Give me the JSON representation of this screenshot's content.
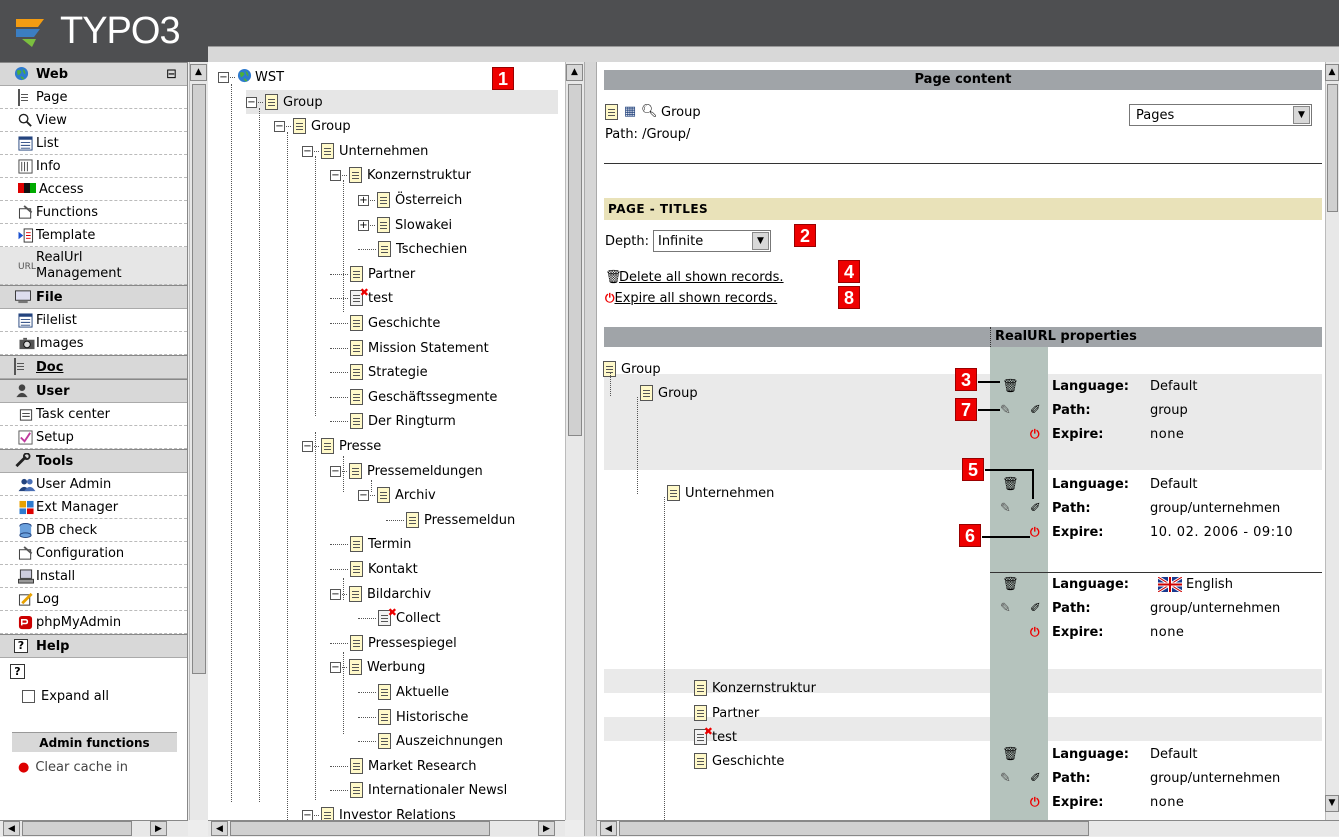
{
  "app": {
    "logo_text": "TYPO3"
  },
  "left_menu": {
    "sections": [
      {
        "title": "Web",
        "icon": "globe-icon",
        "collapse_symbol": "⊟",
        "items": [
          {
            "label": "Page",
            "icon": "page-icon"
          },
          {
            "label": "View",
            "icon": "magnifier-icon"
          },
          {
            "label": "List",
            "icon": "list-icon"
          },
          {
            "label": "Info",
            "icon": "info-icon"
          },
          {
            "label": "Access",
            "icon": "access-icon"
          },
          {
            "label": "Functions",
            "icon": "functions-icon"
          },
          {
            "label": "Template",
            "icon": "template-icon"
          },
          {
            "label": "RealUrl Management",
            "icon": "url-icon",
            "icon_text": "URL"
          }
        ]
      },
      {
        "title": "File",
        "icon": "file-icon",
        "items": [
          {
            "label": "Filelist",
            "icon": "filelist-icon"
          },
          {
            "label": "Images",
            "icon": "camera-icon"
          }
        ]
      },
      {
        "title": "Doc",
        "icon": "doc-icon",
        "items": []
      },
      {
        "title": "User",
        "icon": "user-icon",
        "items": [
          {
            "label": "Task center",
            "icon": "taskcenter-icon"
          },
          {
            "label": "Setup",
            "icon": "setup-icon"
          }
        ]
      },
      {
        "title": "Tools",
        "icon": "tools-icon",
        "items": [
          {
            "label": "User Admin",
            "icon": "useradmin-icon"
          },
          {
            "label": "Ext Manager",
            "icon": "extmanager-icon"
          },
          {
            "label": "DB check",
            "icon": "dbcheck-icon"
          },
          {
            "label": "Configuration",
            "icon": "configuration-icon"
          },
          {
            "label": "Install",
            "icon": "install-icon"
          },
          {
            "label": "Log",
            "icon": "log-icon"
          },
          {
            "label": "phpMyAdmin",
            "icon": "phpmyadmin-icon"
          }
        ]
      },
      {
        "title": "Help",
        "icon": "help-icon",
        "items": []
      }
    ],
    "help_icon_text": "?",
    "expand_all_label": "Expand all",
    "admin_functions_title": "Admin functions",
    "clear_cache_label": "Clear cache in"
  },
  "tree": {
    "badge": "1",
    "nodes": [
      {
        "label": "WST",
        "level": 0,
        "toggle": "⊟",
        "icon": "globe-icon"
      },
      {
        "label": "Group",
        "level": 1,
        "toggle": "⊟",
        "selected": true
      },
      {
        "label": "Group",
        "level": 2,
        "toggle": "⊟"
      },
      {
        "label": "Unternehmen",
        "level": 3,
        "toggle": "⊟"
      },
      {
        "label": "Konzernstruktur",
        "level": 4,
        "toggle": "⊟"
      },
      {
        "label": "Österreich",
        "level": 5,
        "toggle": "⊞"
      },
      {
        "label": "Slowakei",
        "level": 5,
        "toggle": "⊞"
      },
      {
        "label": "Tschechien",
        "level": 5
      },
      {
        "label": "Partner",
        "level": 4
      },
      {
        "label": "test",
        "level": 4,
        "hidden": true
      },
      {
        "label": "Geschichte",
        "level": 4
      },
      {
        "label": "Mission Statement",
        "level": 4
      },
      {
        "label": "Strategie",
        "level": 4
      },
      {
        "label": "Geschäftssegmente",
        "level": 4
      },
      {
        "label": "Der Ringturm",
        "level": 4
      },
      {
        "label": "Presse",
        "level": 3,
        "toggle": "⊟"
      },
      {
        "label": "Pressemeldungen",
        "level": 4,
        "toggle": "⊟"
      },
      {
        "label": "Archiv",
        "level": 5,
        "toggle": "⊟"
      },
      {
        "label": "Pressemeldun",
        "level": 6
      },
      {
        "label": "Termin",
        "level": 4
      },
      {
        "label": "Kontakt",
        "level": 4
      },
      {
        "label": "Bildarchiv",
        "level": 4,
        "toggle": "⊟"
      },
      {
        "label": "Collect",
        "level": 5,
        "hidden": true
      },
      {
        "label": "Pressespiegel",
        "level": 4
      },
      {
        "label": "Werbung",
        "level": 4,
        "toggle": "⊟"
      },
      {
        "label": "Aktuelle",
        "level": 5
      },
      {
        "label": "Historische",
        "level": 5
      },
      {
        "label": "Auszeichnungen",
        "level": 5
      },
      {
        "label": "Market Research",
        "level": 4
      },
      {
        "label": "Internationaler Newsl",
        "level": 4
      },
      {
        "label": "Investor Relations",
        "level": 3,
        "toggle": "⊟"
      }
    ]
  },
  "content": {
    "header_title": "Page content",
    "page_title": "Group",
    "path_label": "Path: /Group/",
    "view_select": "Pages",
    "section_title": "PAGE - TITLES",
    "depth_label": "Depth:",
    "depth_value": "Infinite",
    "delete_all_label": "Delete all shown records.",
    "expire_all_label": "Expire all shown records.",
    "realurl_header": "RealURL properties",
    "badges": {
      "depth": "2",
      "delete": "4",
      "expire": "8",
      "delete_row": "3",
      "edit_row": "7",
      "edit_path": "5",
      "expire_row": "6"
    },
    "prop_labels": {
      "language": "Language:",
      "path": "Path:",
      "expire": "Expire:"
    },
    "tree_rows": [
      {
        "label": "Group",
        "indent": 0
      },
      {
        "label": "Group",
        "indent": 1
      },
      {
        "label": "Unternehmen",
        "indent": 2
      },
      {
        "label": "Konzernstruktur",
        "indent": 3
      },
      {
        "label": "Partner",
        "indent": 3
      },
      {
        "label": "test",
        "indent": 3,
        "hidden": true
      },
      {
        "label": "Geschichte",
        "indent": 3
      }
    ],
    "records": [
      {
        "language": "Default",
        "path": "group",
        "expire": "none",
        "flag": false
      },
      {
        "language": "Default",
        "path": "group/unternehmen",
        "expire": "10. 02. 2006 - 09:10",
        "flag": false
      },
      {
        "language": "English",
        "path": "group/unternehmen",
        "expire": "none",
        "flag": true
      },
      {
        "language": "Default",
        "path": "group/unternehmen",
        "expire": "none",
        "flag": false
      }
    ]
  },
  "colors": {
    "topbar": "#4e4f51",
    "section_bar": "#e9e2b9",
    "realurl_column": "#b5c3bd",
    "badge": "#ee0000"
  }
}
